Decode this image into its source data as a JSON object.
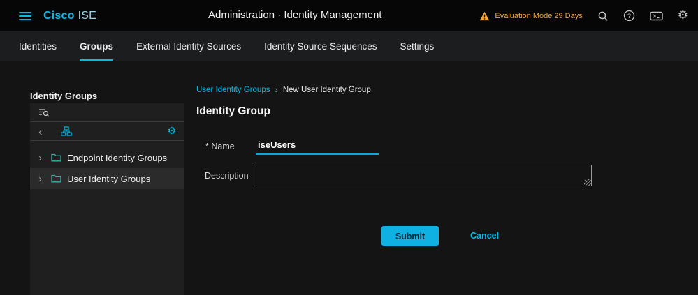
{
  "header": {
    "brand_cisco": "Cisco",
    "brand_ise": "ISE",
    "title": "Administration · Identity Management",
    "evaluation": "Evaluation Mode 29 Days"
  },
  "nav": {
    "tabs": [
      {
        "label": "Identities",
        "active": false
      },
      {
        "label": "Groups",
        "active": true
      },
      {
        "label": "External Identity Sources",
        "active": false
      },
      {
        "label": "Identity Source Sequences",
        "active": false
      },
      {
        "label": "Settings",
        "active": false
      }
    ]
  },
  "sidebar": {
    "title": "Identity Groups",
    "items": [
      {
        "label": "Endpoint Identity Groups",
        "selected": false
      },
      {
        "label": "User Identity Groups",
        "selected": true
      }
    ]
  },
  "main": {
    "breadcrumb": {
      "parent": "User Identity Groups",
      "separator": "›",
      "current": "New User Identity Group"
    },
    "heading": "Identity Group",
    "form": {
      "name_label": "* Name",
      "name_value": "iseUsers",
      "description_label": "Description",
      "description_value": ""
    },
    "buttons": {
      "submit": "Submit",
      "cancel": "Cancel"
    }
  },
  "icons": {
    "gear": "⚙",
    "chevron_left": "‹",
    "chevron_right": "›"
  },
  "colors": {
    "accent": "#00bceb",
    "warning": "#f2a73d",
    "submit_bg": "#0fb0e2"
  }
}
